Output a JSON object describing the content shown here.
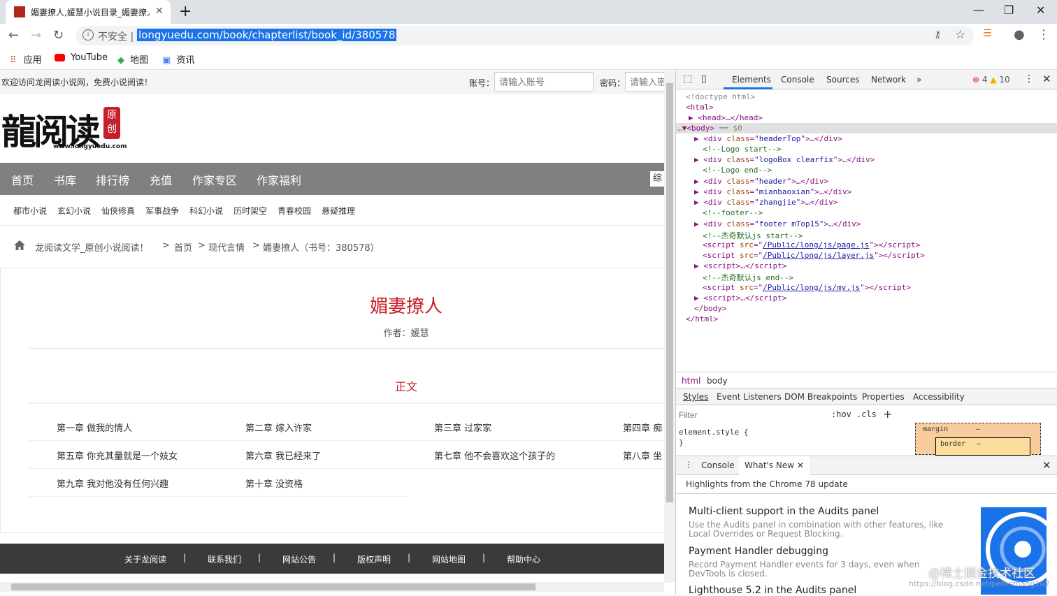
{
  "browser": {
    "tab_title": "媚妻撩人,媛慧小说目录_媚妻撩人",
    "address": {
      "security_label": "不安全",
      "url": "longyuedu.com/book/chapterlist/book_id/380578"
    },
    "bookmarks": [
      {
        "label": "应用",
        "icon": "apps-grid-icon"
      },
      {
        "label": "YouTube",
        "icon": "youtube-icon"
      },
      {
        "label": "地图",
        "icon": "maps-icon"
      },
      {
        "label": "资讯",
        "icon": "news-icon"
      }
    ]
  },
  "site": {
    "welcome": "欢迎访问龙阅读小说网，免费小说阅读！",
    "account_label": "账号：",
    "account_placeholder": "请输入账号",
    "password_label": "密码：",
    "password_placeholder": "请输入密码",
    "logo_text": "龍阅读",
    "logo_seal": "原创",
    "logo_url": "www.longyuedu.com",
    "nav": [
      "首页",
      "书库",
      "排行榜",
      "充值",
      "作家专区",
      "作家福利"
    ],
    "nav_search_text": "综",
    "subnav": [
      "都市小说",
      "玄幻小说",
      "仙侠修真",
      "军事战争",
      "科幻小说",
      "历时架空",
      "青春校园",
      "悬疑推理"
    ],
    "breadcrumb": {
      "site": "龙阅读文学_原创小说阅读！",
      "sep": ">",
      "home": "首页",
      "category": "现代言情",
      "book": "媚妻撩人（书号：380578）"
    },
    "book": {
      "title": "媚妻撩人",
      "author": "作者：媛慧",
      "section": "正文"
    },
    "chapters": [
      "第一章  做我的情人",
      "第二章  嫁入许家",
      "第三章  过家家",
      "第四章  痴",
      "第五章  你充其量就是一个妓女",
      "第六章  我已经来了",
      "第七章  他不会喜欢这个孩子的",
      "第八章  坐",
      "第九章  我对他没有任何兴趣",
      "第十章  没资格"
    ],
    "footer": [
      "关于龙阅读",
      "联系我们",
      "网站公告",
      "版权声明",
      "网站地图",
      "帮助中心"
    ],
    "footer_sep": "|"
  },
  "devtools": {
    "tabs": [
      "Elements",
      "Console",
      "Sources",
      "Network",
      "»"
    ],
    "errors": "4",
    "warnings": "10",
    "dom": {
      "doctype": "<!doctype html>",
      "html_open": "<html>",
      "head": "<head>…</head>",
      "body_open": "<body>",
      "body_suffix": "== $0",
      "html_close": "</html>",
      "body_close": "</body>",
      "cm_logo_start": "<!--Logo start-->",
      "cm_logo_end": "<!--Logo end-->",
      "cm_footer": "<!--footer-->",
      "cm_js_start": "<!--杰奇默认js start-->",
      "cm_js_end": "<!--杰奇默认js end-->",
      "cls_headerTop": "headerTop",
      "cls_logoBox": "logoBox clearfix",
      "cls_header": "header",
      "cls_mianbaoxian": "mianbaoxian",
      "cls_zhangjie": "zhangjie",
      "cls_footer": "footer mTop15",
      "src_page": "/Public/long/js/page.js",
      "src_layer": "/Public/long/js/layer.js",
      "src_my": "/Public/long/js/my.js"
    },
    "crumbs": [
      "html",
      "body"
    ],
    "subtabs": [
      "Styles",
      "Event Listeners",
      "DOM Breakpoints",
      "Properties",
      "Accessibility"
    ],
    "filter_placeholder": "Filter",
    "hov": ":hov",
    "cls": ".cls",
    "element_style": "element.style {",
    "element_style_close": "}",
    "box_margin": "margin",
    "box_border": "border",
    "box_dash": "–",
    "drawer_tabs": [
      "Console",
      "What's New"
    ],
    "highlights": "Highlights from the Chrome 78 update",
    "whats_new": [
      {
        "title": "Multi-client support in the Audits panel",
        "desc": "Use the Audits panel in combination with other features, like Local Overrides or Request Blocking."
      },
      {
        "title": "Payment Handler debugging",
        "desc": "Record Payment Handler events for 3 days, even when DevTools is closed."
      },
      {
        "title": "Lighthouse 5.2 in the Audits panel",
        "desc": ""
      }
    ]
  },
  "watermark": "@稀土掘金技术社区",
  "watermark2": "https://blog.csdn.net/peterzhang102",
  "colors": {
    "accent": "#c8202a",
    "nav_bg": "#808080",
    "footer_bg": "#3a3a3a",
    "chrome_blue": "#1a73e8"
  }
}
